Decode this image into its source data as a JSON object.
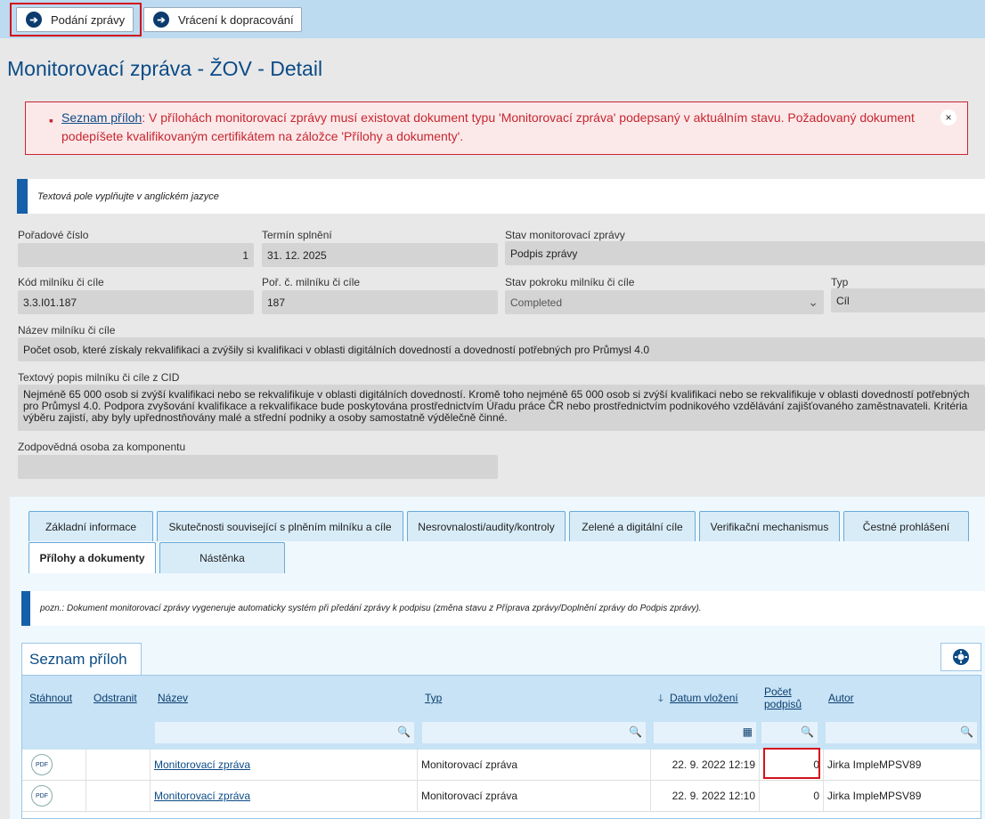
{
  "toolbar": {
    "submit_label": "Podání zprávy",
    "return_label": "Vrácení k dopracování"
  },
  "page_title": "Monitorovací zpráva - ŽOV - Detail",
  "alert": {
    "link": "Seznam příloh",
    "message": ": V přílohách monitorovací zprávy musí existovat dokument typu 'Monitorovací zpráva' podepsaný v aktuálním stavu. Požadovaný dokument podepíšete kvalifikovaným certifikátem na záložce 'Přílohy a dokumenty'.",
    "close": "×"
  },
  "hint_top": "Textová pole vyplňujte v anglickém jazyce",
  "form": {
    "poradove_cislo_label": "Pořadové číslo",
    "poradove_cislo": "1",
    "termin_label": "Termín splnění",
    "termin": "31. 12. 2025",
    "stav_label": "Stav monitorovací zprávy",
    "stav": "Podpis zprávy",
    "kod_label": "Kód milníku či cíle",
    "kod": "3.3.I01.187",
    "por_label": "Poř. č. milníku či cíle",
    "por": "187",
    "pokrok_label": "Stav pokroku milníku či cíle",
    "pokrok": "Completed",
    "typ_label": "Typ",
    "typ": "Cíl",
    "nazev_label": "Název milníku či cíle",
    "nazev": "Počet osob, které získaly rekvalifikaci a zvýšily si kvalifikaci v oblasti digitálních dovedností a dovedností potřebných pro Průmysl 4.0",
    "popis_label": "Textový popis milníku či cíle z CID",
    "popis": "Nejméně 65 000 osob si zvýší kvalifikaci nebo se rekvalifikuje v oblasti digitálních dovedností. Kromě toho nejméně 65 000 osob si zvýší kvalifikaci nebo se rekvalifikuje v oblasti dovedností potřebných pro Průmysl 4.0. Podpora zvyšování kvalifikace a rekvalifikace bude poskytována prostřednictvím Úřadu práce ČR nebo prostřednictvím podnikového vzdělávání zajišťovaného zaměstnavateli. Kritéria výběru zajistí, aby byly upřednostňovány malé a střední podniky a osoby samostatně výdělečně činné.",
    "osoba_label": "Zodpovědná osoba za komponentu",
    "osoba": ""
  },
  "tabs": [
    "Základní informace",
    "Skutečnosti související s plněním milníku a cíle",
    "Nesrovnalosti/audity/kontroly",
    "Zelené a digitální cíle",
    "Verifikační mechanismus",
    "Čestné prohlášení",
    "Přílohy a dokumenty",
    "Nástěnka"
  ],
  "hint_attach": "pozn.: Dokument monitorovací zprávy vygeneruje automaticky systém při předání zprávy k podpisu (změna stavu z Příprava zprávy/Doplnění zprávy do Podpis zprávy).",
  "section_title": "Seznam příloh",
  "table": {
    "headers": [
      "Stáhnout",
      "Odstranit",
      "Název",
      "Typ",
      "Datum vložení",
      "Počet",
      "podpisů",
      "Autor"
    ],
    "rows": [
      {
        "icon": "PDF",
        "nazev": "Monitorovací zpráva",
        "typ": "Monitorovací zpráva",
        "datum": "22. 9. 2022 12:19",
        "pocet": "0",
        "autor": "Jirka ImpleMPSV89"
      },
      {
        "icon": "PDF",
        "nazev": "Monitorovací zpráva",
        "typ": "Monitorovací zpráva",
        "datum": "22. 9. 2022 12:10",
        "pocet": "0",
        "autor": "Jirka ImpleMPSV89"
      }
    ]
  }
}
